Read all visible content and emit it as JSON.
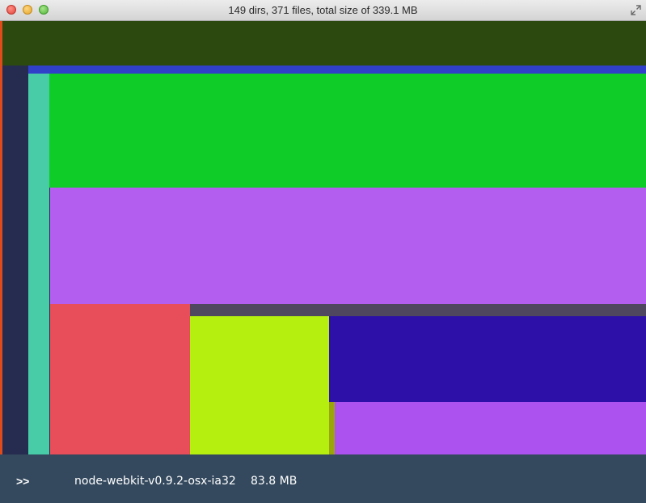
{
  "window": {
    "title": "149 dirs, 371 files, total size of 339.1 MB"
  },
  "treemap": {
    "colors": {
      "top_band": "#2c4a0f",
      "left_edge": "#e04b1c",
      "dark_column": "#262c4f",
      "blue_band": "#3040c8",
      "teal_column": "#48cca8",
      "green_block": "#0fcc28",
      "purple_block": "#b45ef0",
      "red_block": "#e84d5a",
      "grey_band": "#4f4760",
      "lime_block": "#b4ef10",
      "navy_block": "#2c10a8",
      "olive_sliver": "#9ca40c",
      "violet_block": "#ac52ee"
    }
  },
  "statusbar": {
    "prompt": ">>",
    "path": "node-webkit-v0.9.2-osx-ia32",
    "size": "83.8 MB"
  }
}
